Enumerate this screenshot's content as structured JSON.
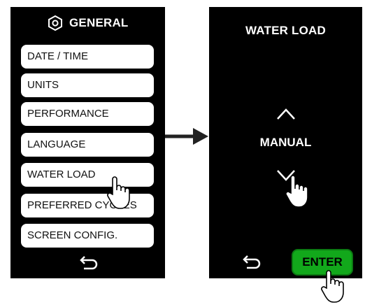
{
  "left_screen": {
    "title": "GENERAL",
    "icon": "gear-icon",
    "menu_items": [
      {
        "label": "DATE / TIME"
      },
      {
        "label": "UNITS"
      },
      {
        "label": "PERFORMANCE"
      },
      {
        "label": "LANGUAGE"
      },
      {
        "label": "WATER LOAD"
      },
      {
        "label": "PREFERRED CYCLES"
      },
      {
        "label": "SCREEN CONFIG."
      }
    ],
    "back_icon": "back-arrow-icon"
  },
  "transition_icon": "right-arrow-icon",
  "right_screen": {
    "title": "WATER LOAD",
    "up_icon": "chevron-up-icon",
    "value": "MANUAL",
    "down_icon": "chevron-down-icon",
    "back_icon": "back-arrow-icon",
    "enter_label": "ENTER",
    "enter_color": "#12a81b"
  },
  "pointer_icon": "hand-pointer-icon"
}
